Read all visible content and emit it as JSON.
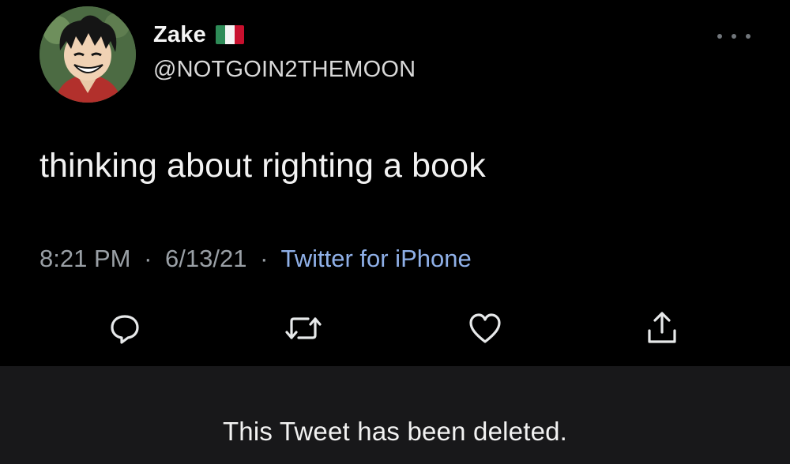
{
  "tweet": {
    "display_name": "Zake",
    "handle": "@NOTGOIN2THEMOON",
    "text": "thinking about righting a book",
    "time": "8:21 PM",
    "date": "6/13/21",
    "separator": "·",
    "source": "Twitter for iPhone",
    "flag_colors": [
      "#2e8b57",
      "#f4f4f4",
      "#c8102e"
    ],
    "avatar_icon": "profile-avatar-icon"
  },
  "header": {
    "more_icon": "more-options-icon"
  },
  "actions": [
    {
      "name": "reply",
      "icon": "reply-icon"
    },
    {
      "name": "retweet",
      "icon": "retweet-icon"
    },
    {
      "name": "like",
      "icon": "heart-icon"
    },
    {
      "name": "share",
      "icon": "share-icon"
    }
  ],
  "banner": {
    "message": "This Tweet has been deleted."
  },
  "colors": {
    "background": "#000000",
    "banner_background": "#18181a",
    "link": "#8fb0e8",
    "muted": "#9aa0a6"
  }
}
